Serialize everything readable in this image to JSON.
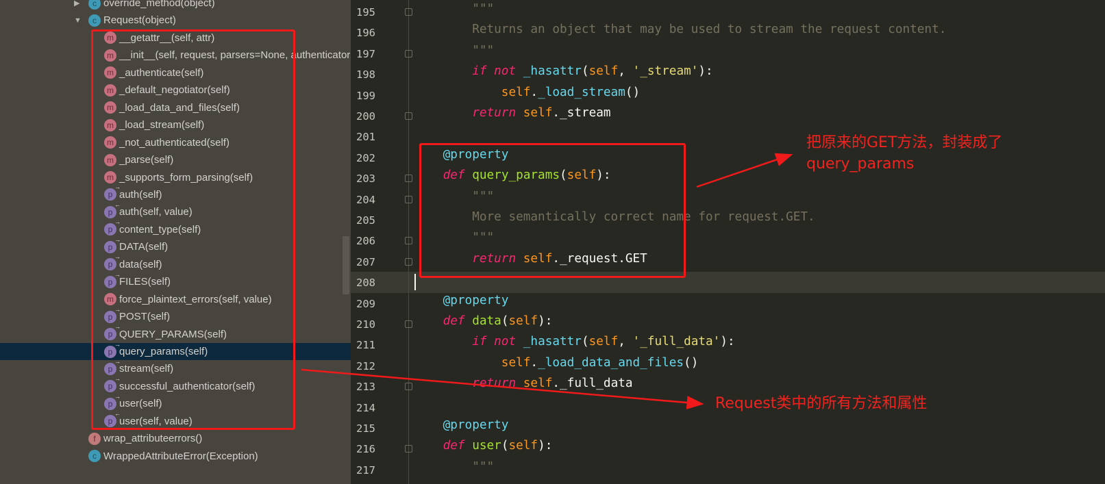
{
  "structure": {
    "items": [
      {
        "label": "override_method(object)",
        "icon": "c",
        "depth": 0,
        "expander": "collapsed"
      },
      {
        "label": "Request(object)",
        "icon": "c",
        "depth": 0,
        "expander": "expanded"
      },
      {
        "label": "__getattr__(self, attr)",
        "icon": "m",
        "depth": 1
      },
      {
        "label": "__init__(self, request, parsers=None, authenticators=None",
        "icon": "m",
        "depth": 1
      },
      {
        "label": "_authenticate(self)",
        "icon": "m",
        "depth": 1
      },
      {
        "label": "_default_negotiator(self)",
        "icon": "m",
        "depth": 1
      },
      {
        "label": "_load_data_and_files(self)",
        "icon": "m",
        "depth": 1
      },
      {
        "label": "_load_stream(self)",
        "icon": "m",
        "depth": 1
      },
      {
        "label": "_not_authenticated(self)",
        "icon": "m",
        "depth": 1
      },
      {
        "label": "_parse(self)",
        "icon": "m",
        "depth": 1
      },
      {
        "label": "_supports_form_parsing(self)",
        "icon": "m",
        "depth": 1
      },
      {
        "label": "auth(self)",
        "icon": "p",
        "depth": 1
      },
      {
        "label": "auth(self, value)",
        "icon": "p-set",
        "depth": 1
      },
      {
        "label": "content_type(self)",
        "icon": "p",
        "depth": 1
      },
      {
        "label": "DATA(self)",
        "icon": "p",
        "depth": 1
      },
      {
        "label": "data(self)",
        "icon": "p",
        "depth": 1
      },
      {
        "label": "FILES(self)",
        "icon": "p",
        "depth": 1
      },
      {
        "label": "force_plaintext_errors(self, value)",
        "icon": "m",
        "depth": 1
      },
      {
        "label": "POST(self)",
        "icon": "p",
        "depth": 1
      },
      {
        "label": "QUERY_PARAMS(self)",
        "icon": "p",
        "depth": 1
      },
      {
        "label": "query_params(self)",
        "icon": "p",
        "depth": 1,
        "selected": true
      },
      {
        "label": "stream(self)",
        "icon": "p",
        "depth": 1
      },
      {
        "label": "successful_authenticator(self)",
        "icon": "p",
        "depth": 1
      },
      {
        "label": "user(self)",
        "icon": "p",
        "depth": 1
      },
      {
        "label": "user(self, value)",
        "icon": "p-set",
        "depth": 1
      },
      {
        "label": "wrap_attributeerrors()",
        "icon": "f",
        "depth": 0
      },
      {
        "label": "WrappedAttributeError(Exception)",
        "icon": "c",
        "depth": 0
      }
    ]
  },
  "editor": {
    "current_line": 208,
    "lines": [
      {
        "n": "195",
        "fold": true,
        "tokens": [
          [
            "        ",
            ""
          ],
          [
            "\"\"\"",
            "cm"
          ]
        ]
      },
      {
        "n": "196",
        "tokens": [
          [
            "        ",
            ""
          ],
          [
            "Returns an object that may be used to stream the request content.",
            "cm"
          ]
        ]
      },
      {
        "n": "197",
        "fold": true,
        "tokens": [
          [
            "        ",
            ""
          ],
          [
            "\"\"\"",
            "cm"
          ]
        ]
      },
      {
        "n": "198",
        "tokens": [
          [
            "        ",
            ""
          ],
          [
            "if not",
            "kw"
          ],
          [
            " ",
            ""
          ],
          [
            "_hasattr",
            "call"
          ],
          [
            "(",
            "pl"
          ],
          [
            "self",
            "self"
          ],
          [
            ", ",
            "pl"
          ],
          [
            "'_stream'",
            "str"
          ],
          [
            "):",
            "pl"
          ]
        ]
      },
      {
        "n": "199",
        "tokens": [
          [
            "            ",
            ""
          ],
          [
            "self",
            "self"
          ],
          [
            ".",
            "pl"
          ],
          [
            "_load_stream",
            "call"
          ],
          [
            "()",
            "pl"
          ]
        ]
      },
      {
        "n": "200",
        "fold": true,
        "tokens": [
          [
            "        ",
            ""
          ],
          [
            "return",
            "kw"
          ],
          [
            " ",
            ""
          ],
          [
            "self",
            "self"
          ],
          [
            "._stream",
            "pl"
          ]
        ]
      },
      {
        "n": "201",
        "tokens": []
      },
      {
        "n": "202",
        "tokens": [
          [
            "    ",
            ""
          ],
          [
            "@property",
            "dec"
          ]
        ]
      },
      {
        "n": "203",
        "fold": true,
        "tokens": [
          [
            "    ",
            ""
          ],
          [
            "def",
            "kw"
          ],
          [
            " ",
            ""
          ],
          [
            "query_params",
            "fn"
          ],
          [
            "(",
            "pl"
          ],
          [
            "self",
            "self"
          ],
          [
            "):",
            "pl"
          ]
        ]
      },
      {
        "n": "204",
        "fold": true,
        "tokens": [
          [
            "        ",
            ""
          ],
          [
            "\"\"\"",
            "cm"
          ]
        ]
      },
      {
        "n": "205",
        "tokens": [
          [
            "        ",
            ""
          ],
          [
            "More semantically correct name for request.GET.",
            "cm"
          ]
        ]
      },
      {
        "n": "206",
        "fold": true,
        "tokens": [
          [
            "        ",
            ""
          ],
          [
            "\"\"\"",
            "cm"
          ]
        ]
      },
      {
        "n": "207",
        "fold": true,
        "tokens": [
          [
            "        ",
            ""
          ],
          [
            "return",
            "kw"
          ],
          [
            " ",
            ""
          ],
          [
            "self",
            "self"
          ],
          [
            "._request.GET",
            "pl"
          ]
        ]
      },
      {
        "n": "208",
        "tokens": []
      },
      {
        "n": "209",
        "tokens": [
          [
            "    ",
            ""
          ],
          [
            "@property",
            "dec"
          ]
        ]
      },
      {
        "n": "210",
        "fold": true,
        "tokens": [
          [
            "    ",
            ""
          ],
          [
            "def",
            "kw"
          ],
          [
            " ",
            ""
          ],
          [
            "data",
            "fn"
          ],
          [
            "(",
            "pl"
          ],
          [
            "self",
            "self"
          ],
          [
            "):",
            "pl"
          ]
        ]
      },
      {
        "n": "211",
        "tokens": [
          [
            "        ",
            ""
          ],
          [
            "if not",
            "kw"
          ],
          [
            " ",
            ""
          ],
          [
            "_hasattr",
            "call"
          ],
          [
            "(",
            "pl"
          ],
          [
            "self",
            "self"
          ],
          [
            ", ",
            "pl"
          ],
          [
            "'_full_data'",
            "str"
          ],
          [
            "):",
            "pl"
          ]
        ]
      },
      {
        "n": "212",
        "tokens": [
          [
            "            ",
            ""
          ],
          [
            "self",
            "self"
          ],
          [
            ".",
            "pl"
          ],
          [
            "_load_data_and_files",
            "call"
          ],
          [
            "()",
            "pl"
          ]
        ]
      },
      {
        "n": "213",
        "fold": true,
        "tokens": [
          [
            "        ",
            ""
          ],
          [
            "return",
            "kw"
          ],
          [
            " ",
            ""
          ],
          [
            "self",
            "self"
          ],
          [
            "._full_data",
            "pl"
          ]
        ]
      },
      {
        "n": "214",
        "tokens": []
      },
      {
        "n": "215",
        "tokens": [
          [
            "    ",
            ""
          ],
          [
            "@property",
            "dec"
          ]
        ]
      },
      {
        "n": "216",
        "fold": true,
        "tokens": [
          [
            "    ",
            ""
          ],
          [
            "def",
            "kw"
          ],
          [
            " ",
            ""
          ],
          [
            "user",
            "fn"
          ],
          [
            "(",
            "pl"
          ],
          [
            "self",
            "self"
          ],
          [
            "):",
            "pl"
          ]
        ]
      },
      {
        "n": "217",
        "tokens": [
          [
            "        ",
            ""
          ],
          [
            "\"\"\"",
            "cm"
          ]
        ]
      }
    ]
  },
  "annotations": {
    "note1_line1": "把原来的GET方法，封装成了",
    "note1_line2": "query_params",
    "note2": "Request类中的所有方法和属性",
    "color": "#f01a1a"
  }
}
